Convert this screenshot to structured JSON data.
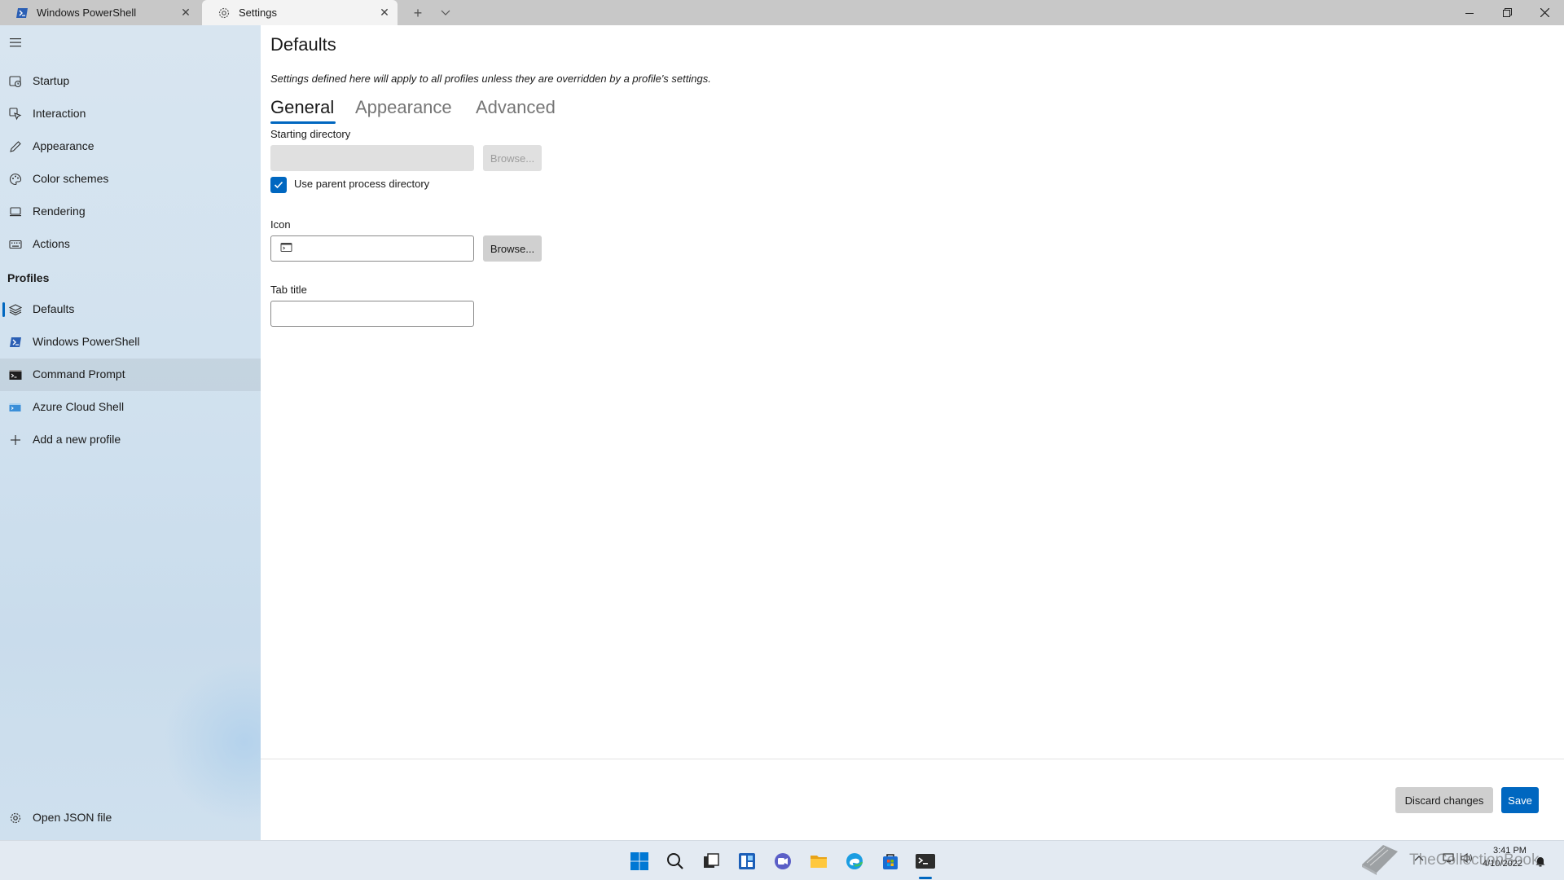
{
  "tabs": [
    {
      "label": "Windows PowerShell",
      "icon": "powershell-icon"
    },
    {
      "label": "Settings",
      "icon": "gear-icon"
    }
  ],
  "sidebar": {
    "items": [
      {
        "label": "Startup",
        "icon": "startup-icon"
      },
      {
        "label": "Interaction",
        "icon": "interaction-icon"
      },
      {
        "label": "Appearance",
        "icon": "pen-icon"
      },
      {
        "label": "Color schemes",
        "icon": "palette-icon"
      },
      {
        "label": "Rendering",
        "icon": "monitor-icon"
      },
      {
        "label": "Actions",
        "icon": "keyboard-icon"
      }
    ],
    "profiles_header": "Profiles",
    "profiles": [
      {
        "label": "Defaults",
        "icon": "layers-icon"
      },
      {
        "label": "Windows PowerShell",
        "icon": "powershell-icon"
      },
      {
        "label": "Command Prompt",
        "icon": "cmd-icon"
      },
      {
        "label": "Azure Cloud Shell",
        "icon": "azure-icon"
      },
      {
        "label": "Add a new profile",
        "icon": "plus-icon"
      }
    ],
    "open_json": {
      "label": "Open JSON file",
      "icon": "gear-icon"
    }
  },
  "main": {
    "title": "Defaults",
    "description": "Settings defined here will apply to all profiles unless they are overridden by a profile's settings.",
    "tabs": [
      {
        "label": "General",
        "selected": true
      },
      {
        "label": "Appearance",
        "selected": false
      },
      {
        "label": "Advanced",
        "selected": false
      }
    ],
    "starting_directory": {
      "label": "Starting directory",
      "value": "",
      "browse_label": "Browse..."
    },
    "use_parent": {
      "label": "Use parent process directory",
      "checked": true
    },
    "icon_field": {
      "label": "Icon",
      "value": "",
      "browse_label": "Browse..."
    },
    "tab_title": {
      "label": "Tab title",
      "value": ""
    },
    "discard_label": "Discard changes",
    "save_label": "Save"
  },
  "taskbar": {
    "icons": [
      "start-icon",
      "search-icon",
      "task-view-icon",
      "widgets-icon",
      "chat-icon",
      "file-explorer-icon",
      "edge-icon",
      "store-icon",
      "terminal-icon"
    ],
    "time": "3:41 PM",
    "date": "4/10/2022",
    "watermark": "TheCollectionBook"
  },
  "colors": {
    "accent": "#0067c0",
    "sidebar_bg": "#d2e2ef",
    "titlebar": "#c8c8c8"
  }
}
